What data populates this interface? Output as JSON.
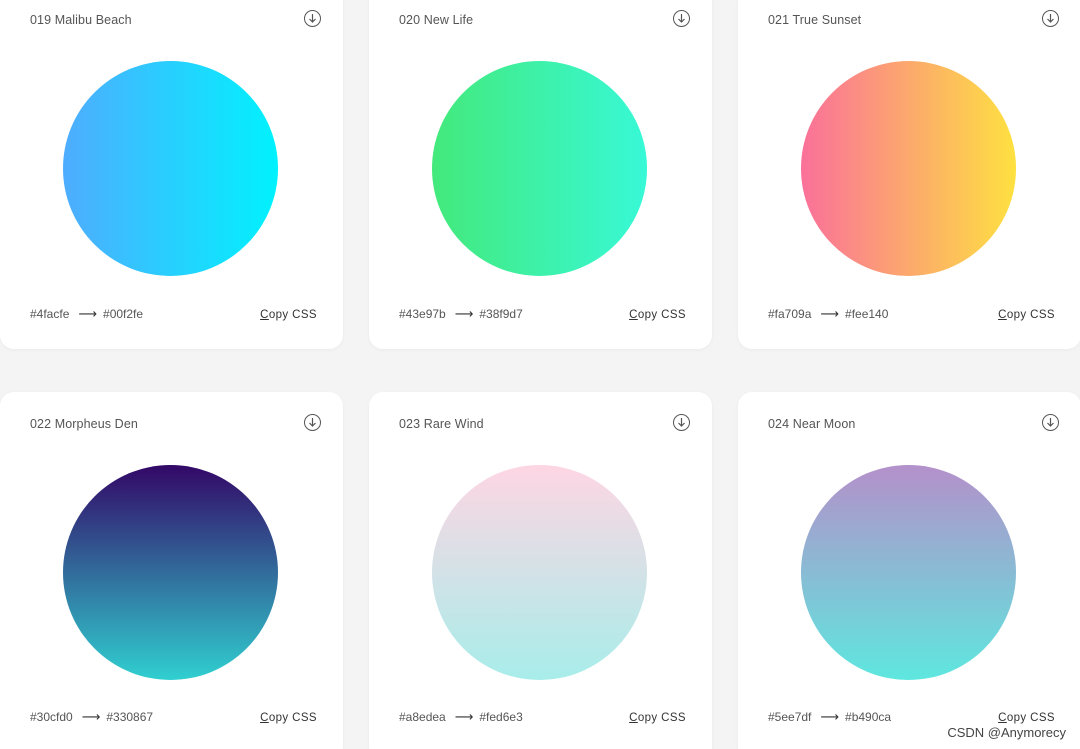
{
  "gradients": [
    {
      "title": "019 Malibu Beach",
      "from": "#4facfe",
      "to": "#00f2fe",
      "arrow": "⟶",
      "direction": "to right",
      "copy_first": "C",
      "copy_rest": "opy CSS"
    },
    {
      "title": "020 New Life",
      "from": "#43e97b",
      "to": "#38f9d7",
      "arrow": "⟶",
      "direction": "to right",
      "copy_first": "C",
      "copy_rest": "opy CSS"
    },
    {
      "title": "021 True Sunset",
      "from": "#fa709a",
      "to": "#fee140",
      "arrow": "⟶",
      "direction": "to right",
      "copy_first": "C",
      "copy_rest": "opy CSS"
    },
    {
      "title": "022 Morpheus Den",
      "from": "#30cfd0",
      "to": "#330867",
      "arrow": "⟶",
      "direction": "to top",
      "copy_first": "C",
      "copy_rest": "opy CSS"
    },
    {
      "title": "023 Rare Wind",
      "from": "#a8edea",
      "to": "#fed6e3",
      "arrow": "⟶",
      "direction": "to top",
      "copy_first": "C",
      "copy_rest": "opy CSS"
    },
    {
      "title": "024 Near Moon",
      "from": "#5ee7df",
      "to": "#b490ca",
      "arrow": "⟶",
      "direction": "to top",
      "copy_first": "C",
      "copy_rest": "opy CSS"
    }
  ],
  "watermark": "CSDN @Anymorecy"
}
